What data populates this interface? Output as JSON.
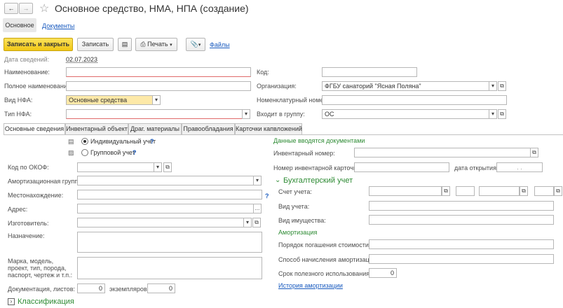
{
  "window": {
    "title": "Основное средство, НМА, НПА (создание)",
    "back_icon": "arrow-left-icon",
    "forward_icon": "arrow-right-icon",
    "star_icon": "star-icon"
  },
  "nav_tabs": {
    "main": "Основное",
    "documents": "Документы"
  },
  "toolbar": {
    "save_close": "Записать и закрыть",
    "save": "Записать",
    "print": "Печать",
    "files": "Файлы"
  },
  "header": {
    "date_label": "Дата сведений:",
    "date_value": "02.07.2023",
    "name_label": "Наименование:",
    "name_value": "",
    "full_name_label": "Полное наименование:",
    "full_name_value": "",
    "nfa_kind_label": "Вид НФА:",
    "nfa_kind_value": "Основные средства",
    "nfa_type_label": "Тип НФА:",
    "nfa_type_value": "",
    "code_label": "Код:",
    "code_value": "",
    "org_label": "Организация:",
    "org_value": "ФГБУ санаторий \"Ясная Поляна\"",
    "nomen_label": "Номенклатурный номер:",
    "nomen_value": "",
    "group_label": "Входит в группу:",
    "group_value": "ОС"
  },
  "tabs": [
    "Основные сведения",
    "Инвентарный объект",
    "Драг. материалы",
    "Правообладания",
    "Карточки капвложений"
  ],
  "left": {
    "individual": "Индивидуальный учет",
    "group": "Групповой учет",
    "help": "?",
    "okof_label": "Код по ОКОФ:",
    "amort_group_label": "Амортизационная группа:",
    "location_label": "Местонахождение:",
    "address_label": "Адрес:",
    "maker_label": "Изготовитель:",
    "purpose_label": "Назначение:",
    "brand_label": "Марка, модель, проект, тип, порода, паспорт, чертеж и т.п.:",
    "docs_label": "Документация, листов:",
    "docs_sheets": "0",
    "copies_label": "экземпляров:",
    "copies_value": "0",
    "classification": "Классификация"
  },
  "right": {
    "notice": "Данные вводятся документами",
    "inv_number_label": "Инвентарный номер:",
    "inv_card_label": "Номер инвентарной карточки:",
    "open_date_label": "дата открытия:",
    "open_date_value": ". .",
    "accounting_title": "Бухгалтерский учет",
    "account_label": "Счет учета:",
    "acc_kind_label": "Вид учета:",
    "property_kind_label": "Вид имущества:",
    "amort_title": "Амортизация",
    "repay_label": "Порядок погашения стоимости:",
    "calc_method_label": "Способ начисления амортизации:",
    "useful_life_label": "Срок полезного использования:",
    "useful_life_value": "0",
    "history_link": "История амортизации"
  },
  "colors": {
    "accent_yellow": "#f5d42f",
    "link_blue": "#1a5bbf",
    "section_green": "#2e8b34",
    "required_red": "#e06a6a"
  }
}
